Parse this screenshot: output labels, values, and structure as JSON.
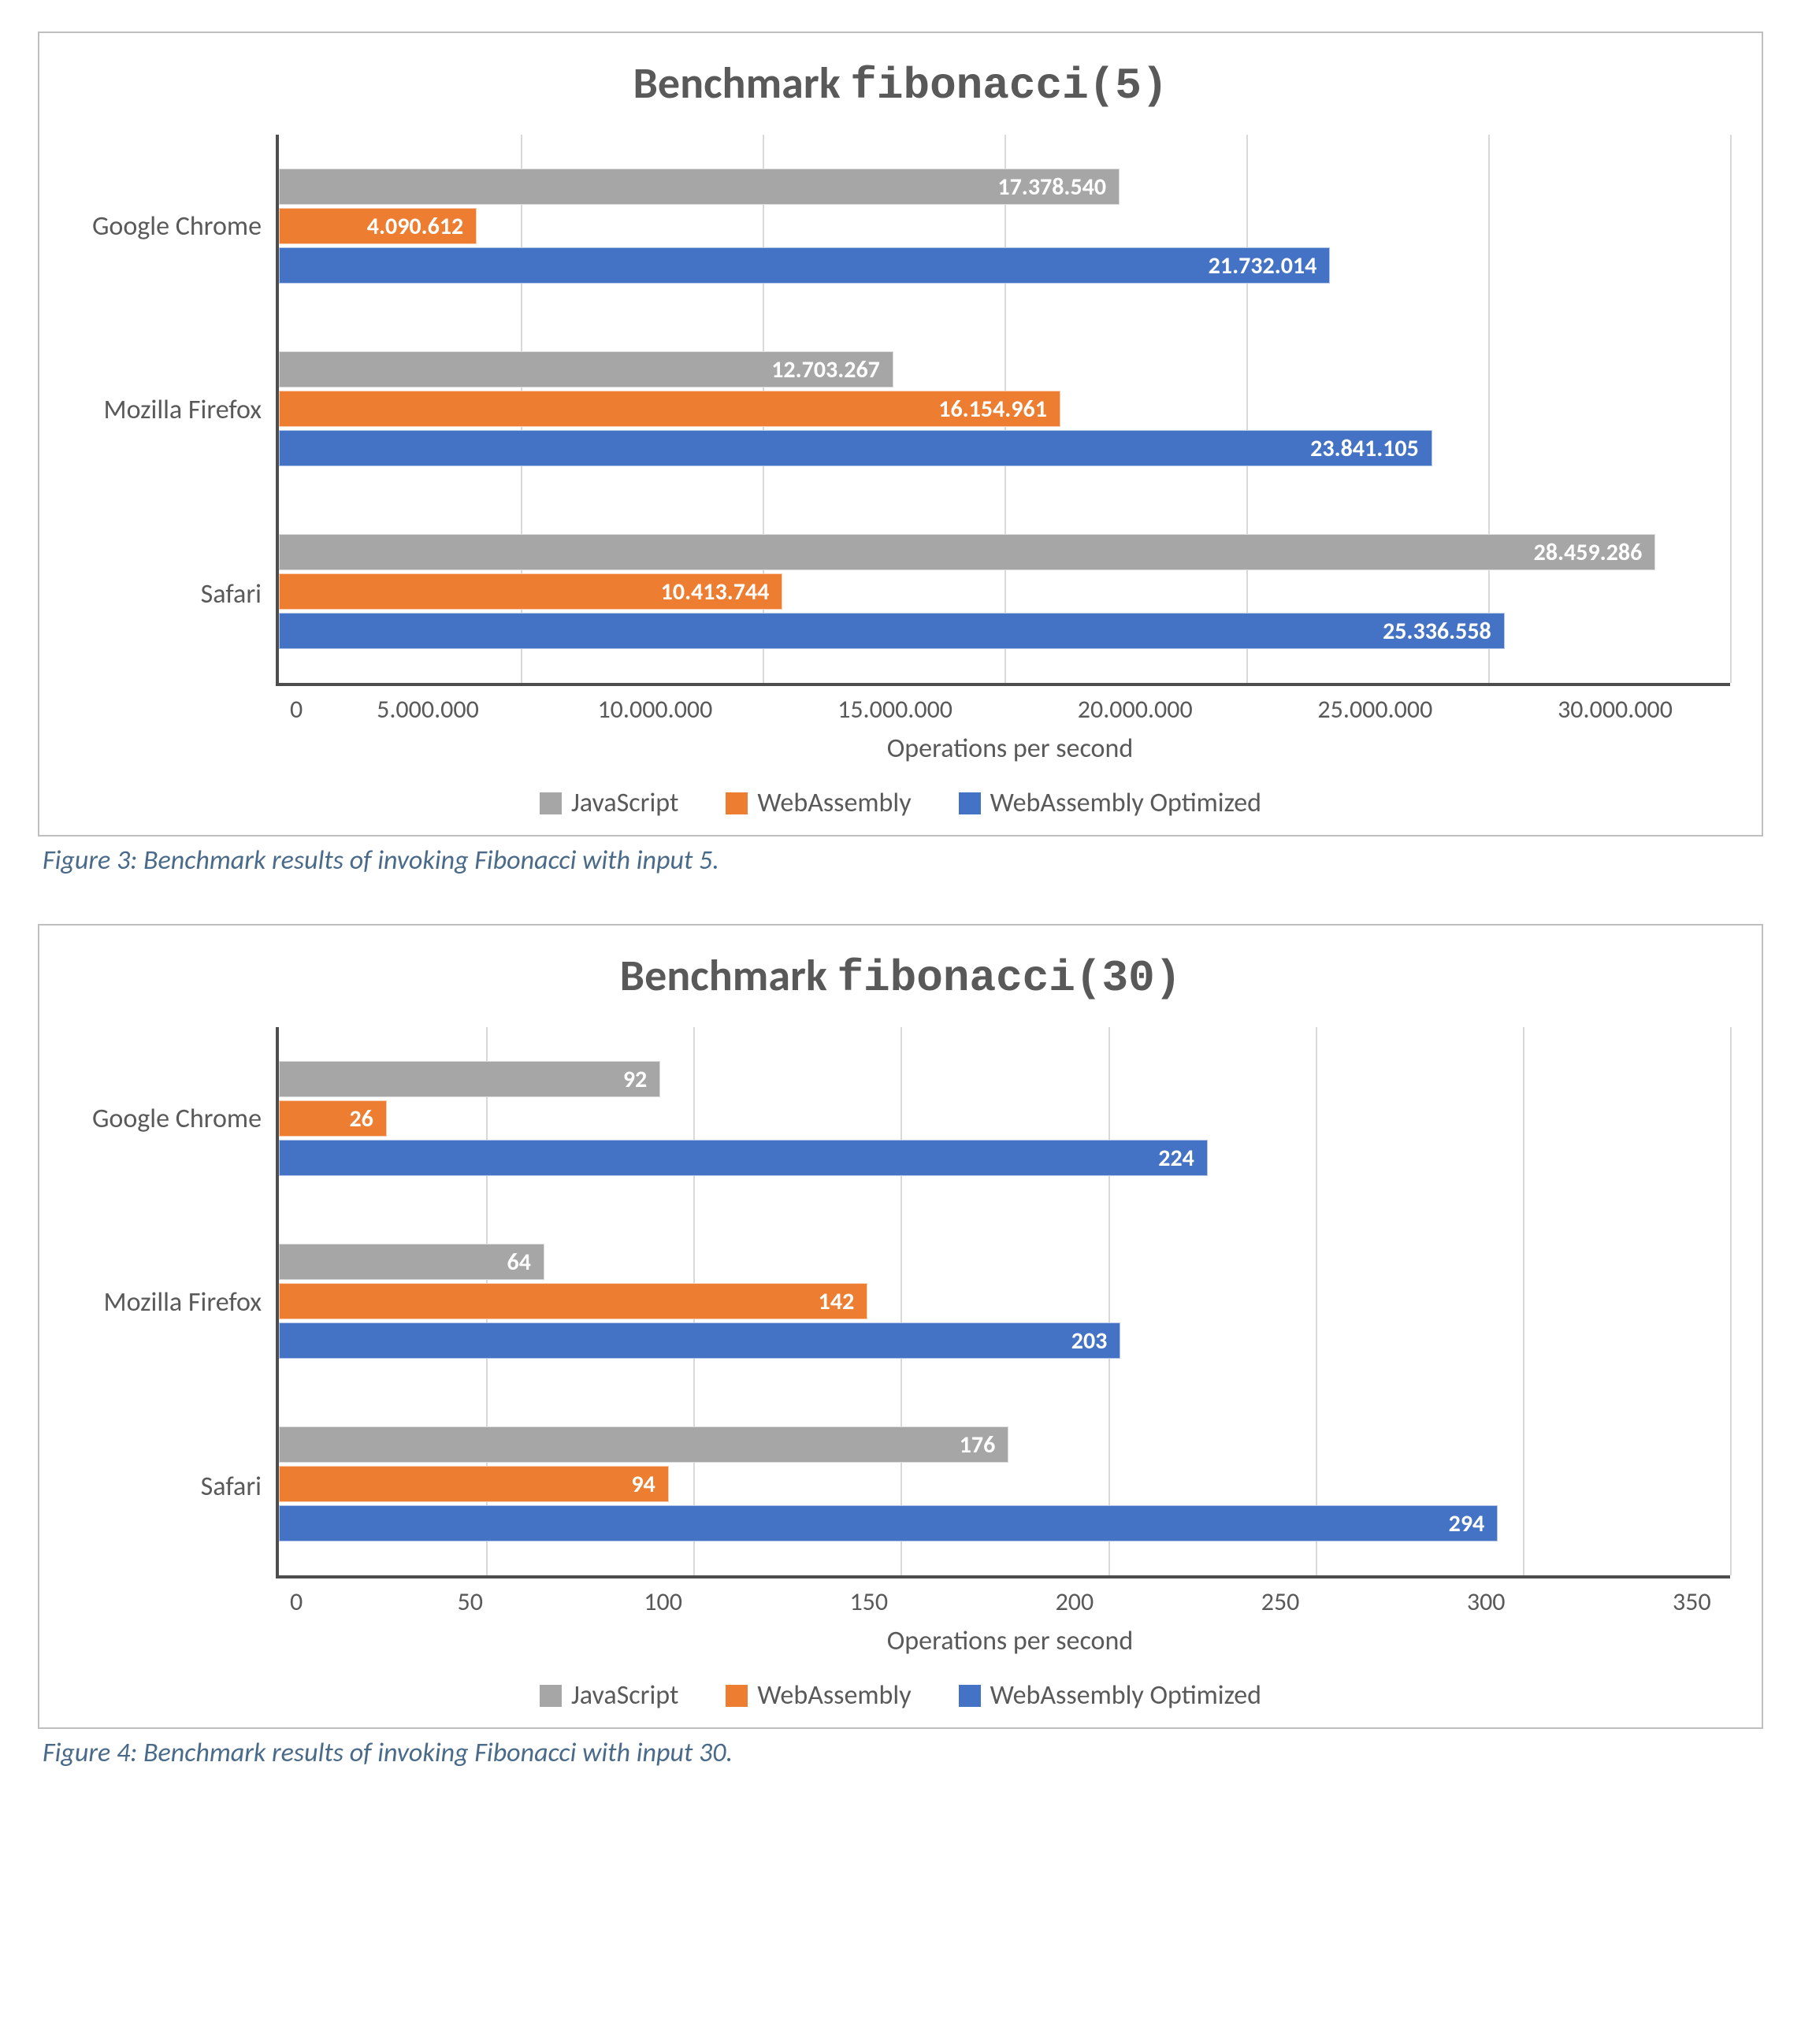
{
  "chart_data": [
    {
      "type": "bar",
      "orientation": "horizontal",
      "title_prefix": "Benchmark ",
      "title_code": "fibonacci(5)",
      "xlabel": "Operations per second",
      "categories": [
        "Google Chrome",
        "Mozilla Firefox",
        "Safari"
      ],
      "series": [
        {
          "name": "JavaScript",
          "values": [
            17378540,
            12703267,
            28459286
          ],
          "labels": [
            "17.378.540",
            "12.703.267",
            "28.459.286"
          ]
        },
        {
          "name": "WebAssembly",
          "values": [
            4090612,
            16154961,
            10413744
          ],
          "labels": [
            "4.090.612",
            "16.154.961",
            "10.413.744"
          ]
        },
        {
          "name": "WebAssembly Optimized",
          "values": [
            21732014,
            23841105,
            25336558
          ],
          "labels": [
            "21.732.014",
            "23.841.105",
            "25.336.558"
          ]
        }
      ],
      "x_ticks": [
        "0",
        "5.000.000",
        "10.000.000",
        "15.000.000",
        "20.000.000",
        "25.000.000",
        "30.000.000"
      ],
      "xlim": [
        0,
        30000000
      ],
      "caption": "Figure 3: Benchmark results of invoking Fibonacci with input 5."
    },
    {
      "type": "bar",
      "orientation": "horizontal",
      "title_prefix": "Benchmark ",
      "title_code": "fibonacci(30)",
      "xlabel": "Operations per second",
      "categories": [
        "Google Chrome",
        "Mozilla Firefox",
        "Safari"
      ],
      "series": [
        {
          "name": "JavaScript",
          "values": [
            92,
            64,
            176
          ],
          "labels": [
            "92",
            "64",
            "176"
          ]
        },
        {
          "name": "WebAssembly",
          "values": [
            26,
            142,
            94
          ],
          "labels": [
            "26",
            "142",
            "94"
          ]
        },
        {
          "name": "WebAssembly Optimized",
          "values": [
            224,
            203,
            294
          ],
          "labels": [
            "224",
            "203",
            "294"
          ]
        }
      ],
      "x_ticks": [
        "0",
        "50",
        "100",
        "150",
        "200",
        "250",
        "300",
        "350"
      ],
      "xlim": [
        0,
        350
      ],
      "caption": "Figure 4: Benchmark results of invoking Fibonacci with input 30."
    }
  ],
  "legend": {
    "js": "JavaScript",
    "wasm": "WebAssembly",
    "opt": "WebAssembly Optimized"
  },
  "colors": {
    "js": "#a6a6a6",
    "wasm": "#ed7d31",
    "opt": "#4472c4"
  }
}
